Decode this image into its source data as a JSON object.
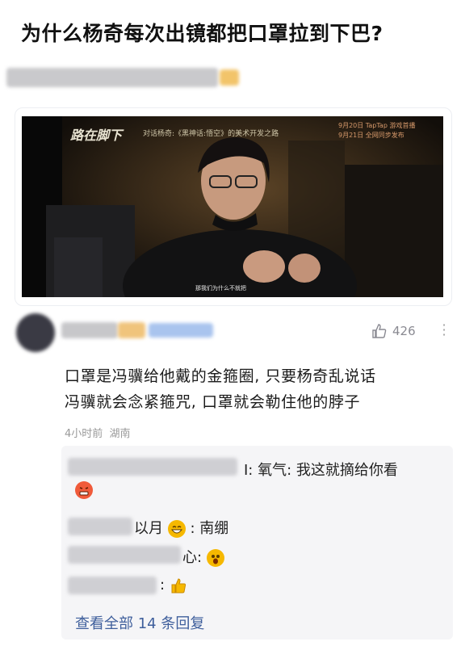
{
  "question": {
    "title": "为什么杨奇每次出镜都把口罩拉到下巴?"
  },
  "video": {
    "show_title": "路在脚下",
    "subtitle": "对话杨奇:《黑神话:悟空》的美术开发之路",
    "date_line1": "9月20日 TapTap 游戏首播",
    "date_line2": "9月21日 全网同步发布",
    "caption": "那我们为什么不就把"
  },
  "comment": {
    "likes": "426",
    "text_line1": "口罩是冯骥给他戴的金箍圈, 只要杨奇乱说话",
    "text_line2": "冯骥就会念紧箍咒, 口罩就会勒住他的脖子",
    "time": "4小时前",
    "location": "湖南"
  },
  "replies": {
    "items": [
      {
        "suffix": "I:",
        "text": "氧气: 我这就摘给你看"
      },
      {
        "suffix": "以月",
        "text": ": 南绷"
      },
      {
        "suffix": "心:",
        "text": ""
      },
      {
        "suffix": ":",
        "text": ""
      }
    ],
    "view_all": "查看全部 14 条回复"
  },
  "colors": {
    "link": "#3f5f9c",
    "muted": "#999999",
    "reply_bg": "#f5f5f7"
  },
  "icons": [
    "thumbs-up-icon",
    "more-vertical-icon",
    "angry-face-emoji",
    "grinning-face-emoji",
    "astonished-face-emoji",
    "thumbs-up-emoji"
  ]
}
